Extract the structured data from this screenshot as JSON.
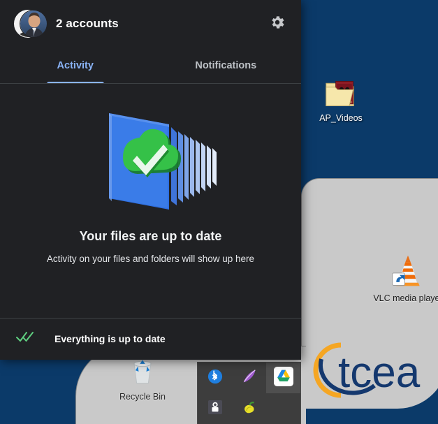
{
  "flyout": {
    "header": {
      "account_summary": "2 accounts",
      "avatar_icon": "user-avatar",
      "settings_icon": "gear-icon"
    },
    "tabs": [
      {
        "label": "Activity",
        "active": true
      },
      {
        "label": "Notifications",
        "active": false
      }
    ],
    "empty_state": {
      "illustration_icon": "cloud-check-files-stack",
      "title": "Your files are up to date",
      "subtitle": "Activity on your files and folders will show up here"
    },
    "footer": {
      "status_icon": "double-check-icon",
      "status_text": "Everything is up to date",
      "status_color": "#5fcf80"
    }
  },
  "desktop": {
    "background_color": "#0b3a69",
    "icons": [
      {
        "label": "AP_Videos",
        "icon": "folder-icon"
      },
      {
        "label": "VLC media player",
        "icon": "vlc-cone-icon"
      },
      {
        "label": "Recycle Bin",
        "icon": "recycle-bin-icon"
      }
    ],
    "logo_text": "tcea",
    "logo_colors": {
      "text": "#14386e",
      "swoosh": "#f5a623"
    }
  },
  "tray": {
    "icons": [
      {
        "name": "bluetooth-icon",
        "highlighted": false
      },
      {
        "name": "feather-icon",
        "highlighted": false
      },
      {
        "name": "google-drive-icon",
        "highlighted": true
      },
      {
        "name": "safely-remove-hardware-icon",
        "highlighted": false
      },
      {
        "name": "pepper-icon",
        "highlighted": false
      }
    ]
  }
}
